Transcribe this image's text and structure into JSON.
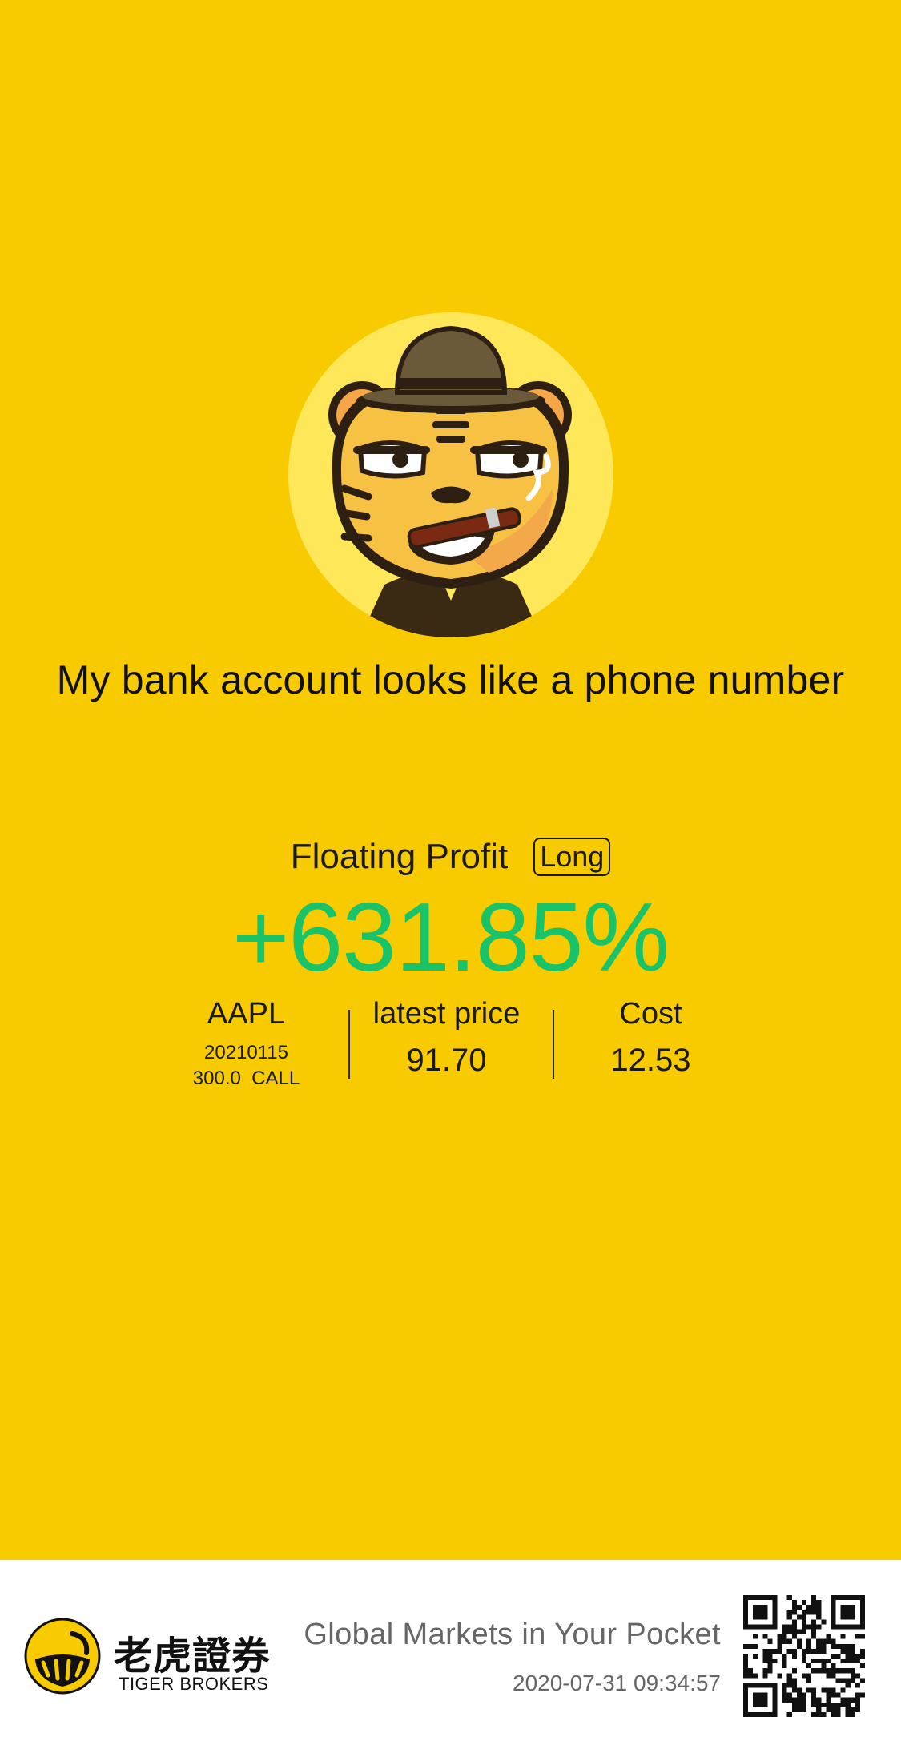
{
  "tagline": "My bank account looks like a phone number",
  "profit": {
    "label": "Floating Profit",
    "badge": "Long",
    "percent": "+631.85%",
    "color": "#19C36A"
  },
  "stats": {
    "symbol": "AAPL",
    "expiry": "20210115",
    "strike_type": "300.0  CALL",
    "latest_price_label": "latest price",
    "latest_price": "91.70",
    "cost_label": "Cost",
    "cost": "12.53"
  },
  "footer": {
    "logo_cn": "老虎證券",
    "logo_en": "TIGER BROKERS",
    "slogan": "Global Markets in Your Pocket",
    "timestamp": "2020-07-31 09:34:57"
  },
  "colors": {
    "background": "#F7CB00",
    "footer_bg": "#FFFFFF",
    "text": "#111111",
    "footer_text": "#666666"
  },
  "icons": [
    "tiger-avatar-icon",
    "tiger-brokers-logo-icon",
    "qr-code-icon"
  ]
}
